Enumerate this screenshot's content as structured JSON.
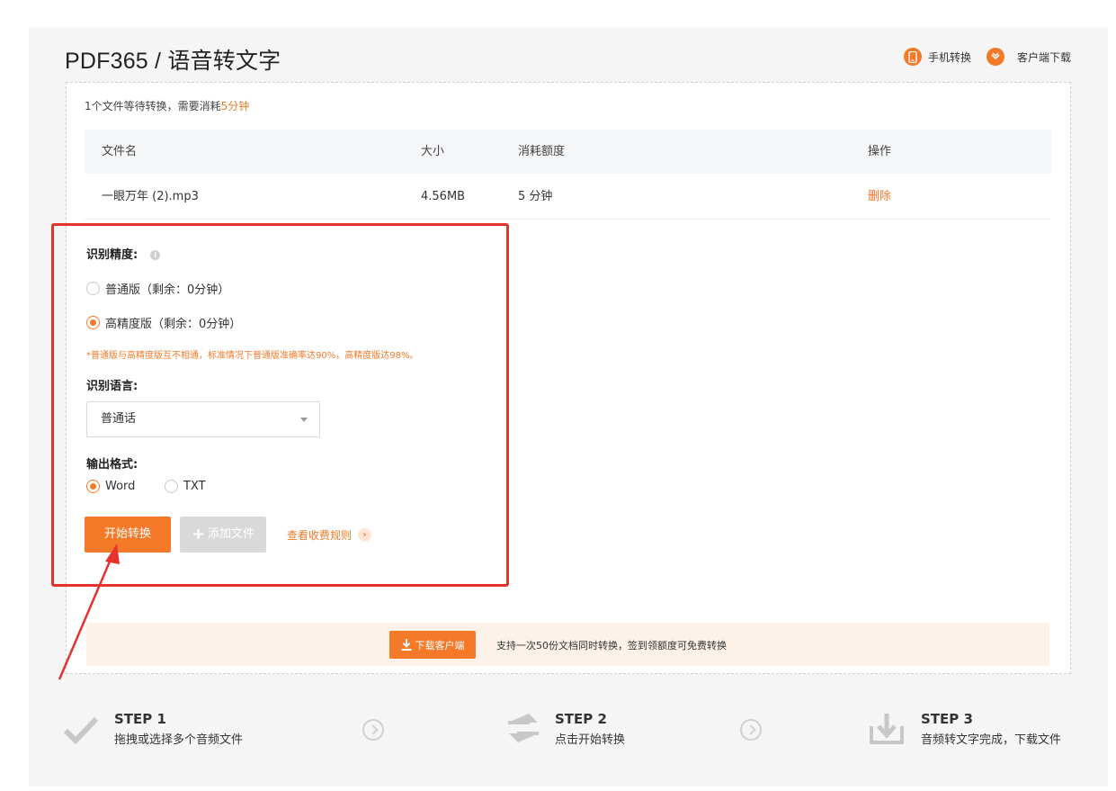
{
  "header": {
    "title": "PDF365 / 语音转文字",
    "mobile_label": "手机转换",
    "client_label": "客户端下载"
  },
  "queue": {
    "prefix": "1个文件等待转换，需要消耗",
    "time": "5分钟"
  },
  "table": {
    "columns": [
      "文件名",
      "大小",
      "消耗额度",
      "操作"
    ],
    "rows": [
      {
        "name": "一眼万年 (2).mp3",
        "size": "4.56MB",
        "cost": "5 分钟",
        "action": "删除"
      }
    ]
  },
  "options": {
    "accuracy_label": "识别精度:",
    "accuracy_options": [
      {
        "label": "普通版（剩余：0分钟）",
        "selected": false
      },
      {
        "label": "高精度版（剩余：0分钟）",
        "selected": true
      }
    ],
    "accuracy_note": "*普通版与高精度版互不相通，标准情况下普通版准确率达90%，高精度版达98%。",
    "language_label": "识别语言:",
    "language_value": "普通话",
    "format_label": "输出格式:",
    "format_options": [
      {
        "label": "Word",
        "selected": true
      },
      {
        "label": "TXT",
        "selected": false
      }
    ]
  },
  "actions": {
    "start_label": "开始转换",
    "add_label": "添加文件",
    "fee_label": "查看收费规则"
  },
  "banner": {
    "download_label": "下载客户端",
    "text": "支持一次50份文档同时转换，签到领额度可免费转换"
  },
  "steps": [
    {
      "title": "STEP 1",
      "desc": "拖拽或选择多个音频文件"
    },
    {
      "title": "STEP 2",
      "desc": "点击开始转换"
    },
    {
      "title": "STEP 3",
      "desc": "音频转文字完成，下载文件"
    }
  ],
  "colors": {
    "accent": "#f47a29",
    "highlight": "#e5322d"
  },
  "icons": [
    "phone-icon",
    "client-download-icon",
    "info-icon",
    "download-icon",
    "check-icon",
    "swap-icon",
    "tray-download-icon",
    "chevron-right-icon"
  ]
}
